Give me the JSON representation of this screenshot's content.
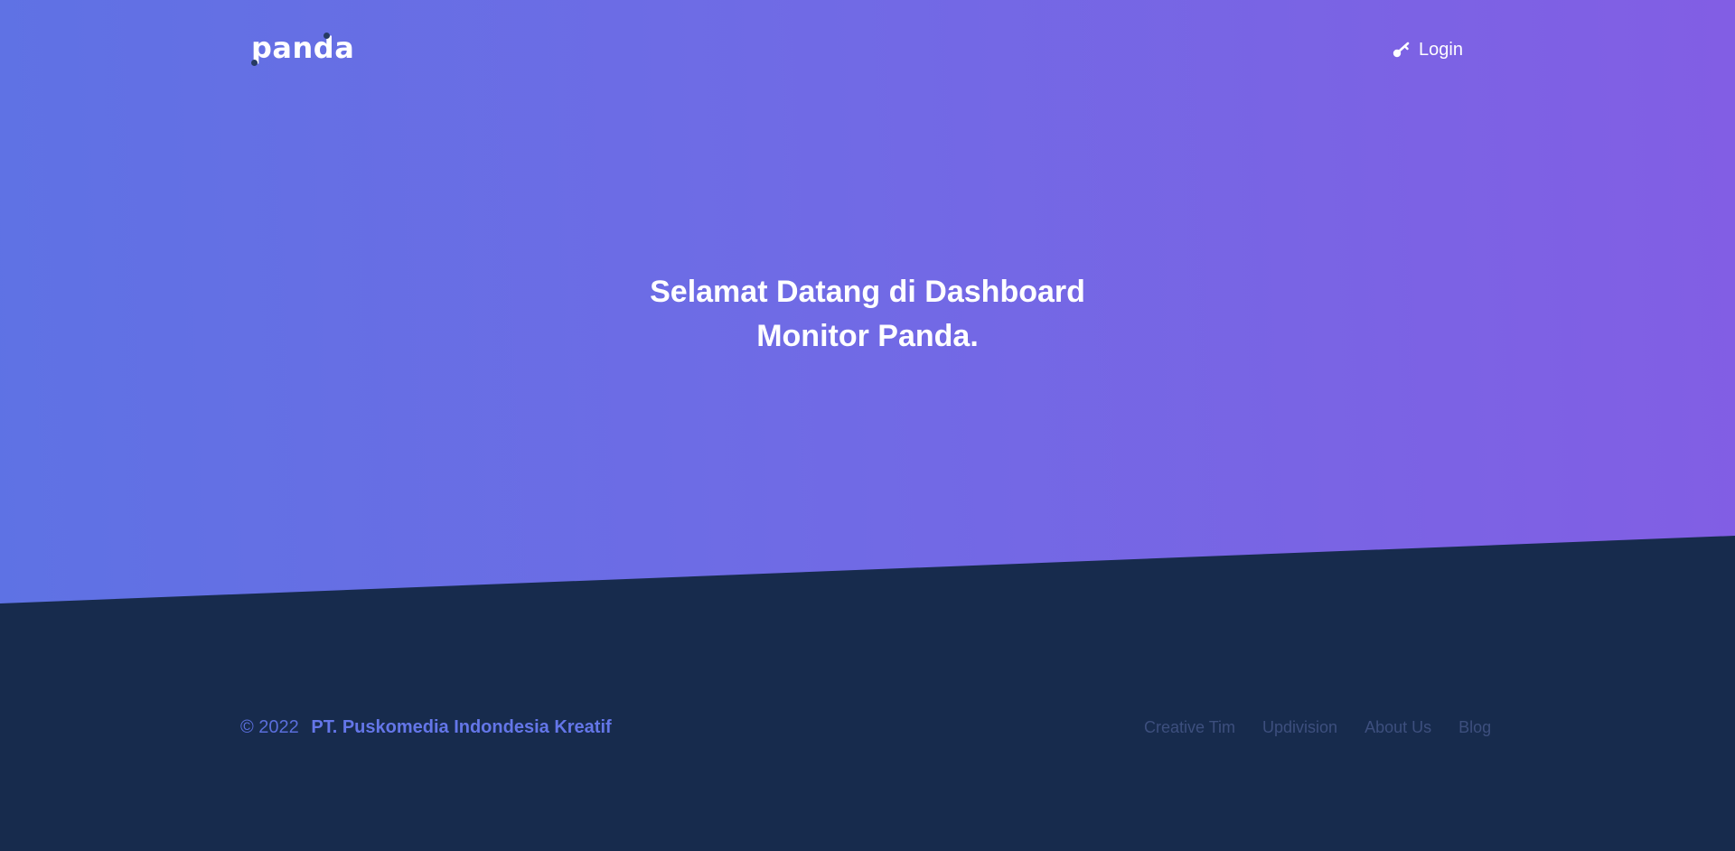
{
  "colors": {
    "gradient_start": "#5e72e4",
    "gradient_end": "#825ee4",
    "footer_background": "#172b4d",
    "accent": "#5e72e4",
    "footer_link": "#3d4f7e"
  },
  "navbar": {
    "brand": "panda",
    "login": {
      "icon": "key-icon",
      "label": "Login"
    }
  },
  "hero": {
    "title_line1": "Selamat Datang di Dashboard",
    "title_line2": "Monitor Panda."
  },
  "footer": {
    "copyright_year": "© 2022",
    "company": "PT. Puskomedia Indondesia Kreatif",
    "links": [
      {
        "label": "Creative Tim"
      },
      {
        "label": "Updivision"
      },
      {
        "label": "About Us"
      },
      {
        "label": "Blog"
      }
    ]
  }
}
